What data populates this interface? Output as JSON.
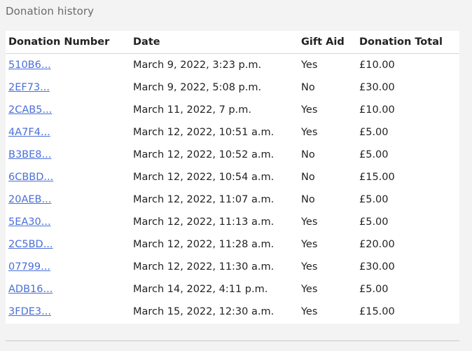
{
  "page": {
    "title": "Donation history"
  },
  "table": {
    "columns": [
      "Donation Number",
      "Date",
      "Gift Aid",
      "Donation Total"
    ],
    "rows": [
      {
        "number": "510B6...",
        "date": "March 9, 2022, 3:23 p.m.",
        "gift_aid": "Yes",
        "total": "£10.00"
      },
      {
        "number": "2EF73...",
        "date": "March 9, 2022, 5:08 p.m.",
        "gift_aid": "No",
        "total": "£30.00"
      },
      {
        "number": "2CAB5...",
        "date": "March 11, 2022, 7 p.m.",
        "gift_aid": "Yes",
        "total": "£10.00"
      },
      {
        "number": "4A7F4...",
        "date": "March 12, 2022, 10:51 a.m.",
        "gift_aid": "Yes",
        "total": "£5.00"
      },
      {
        "number": "B3BE8...",
        "date": "March 12, 2022, 10:52 a.m.",
        "gift_aid": "No",
        "total": "£5.00"
      },
      {
        "number": "6CBBD...",
        "date": "March 12, 2022, 10:54 a.m.",
        "gift_aid": "No",
        "total": "£15.00"
      },
      {
        "number": "20AEB...",
        "date": "March 12, 2022, 11:07 a.m.",
        "gift_aid": "No",
        "total": "£5.00"
      },
      {
        "number": "5EA30...",
        "date": "March 12, 2022, 11:13 a.m.",
        "gift_aid": "Yes",
        "total": "£5.00"
      },
      {
        "number": "2C5BD...",
        "date": "March 12, 2022, 11:28 a.m.",
        "gift_aid": "Yes",
        "total": "£20.00"
      },
      {
        "number": "07799...",
        "date": "March 12, 2022, 11:30 a.m.",
        "gift_aid": "Yes",
        "total": "£30.00"
      },
      {
        "number": "ADB16...",
        "date": "March 14, 2022, 4:11 p.m.",
        "gift_aid": "Yes",
        "total": "£5.00"
      },
      {
        "number": "3FDE3...",
        "date": "March 15, 2022, 12:30 a.m.",
        "gift_aid": "Yes",
        "total": "£15.00"
      }
    ]
  },
  "colors": {
    "background": "#f3f3f4",
    "link": "#4a6fd8",
    "title": "#6b6b6b"
  }
}
